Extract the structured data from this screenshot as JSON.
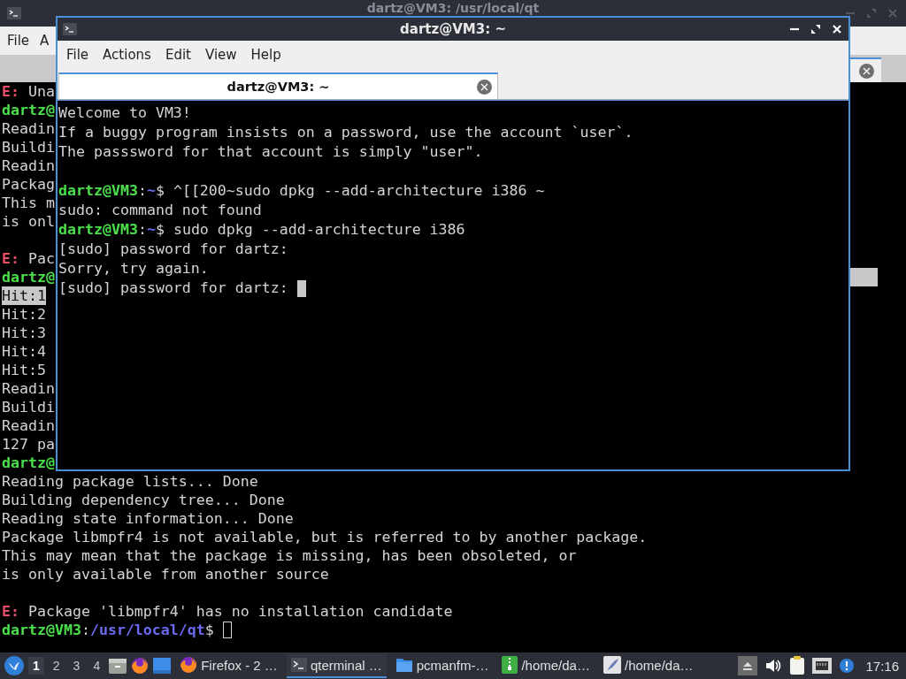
{
  "background_window": {
    "title": "dartz@VM3: /usr/local/qt",
    "focused": false,
    "menu": [
      "File",
      "A"
    ],
    "lines": [
      {
        "kind": "text",
        "parts": [
          {
            "kind": "error",
            "text": "E:"
          },
          {
            "kind": "plain",
            "text": " Una"
          }
        ]
      },
      {
        "kind": "text",
        "parts": [
          {
            "kind": "user",
            "text": "dartz@"
          }
        ]
      },
      {
        "kind": "text",
        "parts": [
          {
            "kind": "plain",
            "text": "Readin"
          }
        ]
      },
      {
        "kind": "text",
        "parts": [
          {
            "kind": "plain",
            "text": "Buildi"
          }
        ]
      },
      {
        "kind": "text",
        "parts": [
          {
            "kind": "plain",
            "text": "Readin"
          }
        ]
      },
      {
        "kind": "text",
        "parts": [
          {
            "kind": "plain",
            "text": "Packag"
          }
        ]
      },
      {
        "kind": "text",
        "parts": [
          {
            "kind": "plain",
            "text": "This m"
          }
        ]
      },
      {
        "kind": "text",
        "parts": [
          {
            "kind": "plain",
            "text": "is onl"
          }
        ]
      },
      {
        "kind": "blank"
      },
      {
        "kind": "text",
        "parts": [
          {
            "kind": "error",
            "text": "E:"
          },
          {
            "kind": "plain",
            "text": " Pac"
          }
        ]
      },
      {
        "kind": "text",
        "selected_end": true,
        "parts": [
          {
            "kind": "user",
            "text": "dartz@"
          }
        ]
      },
      {
        "kind": "text",
        "selected": true,
        "parts": [
          {
            "kind": "plain",
            "text": "Hit:1"
          }
        ]
      },
      {
        "kind": "text",
        "parts": [
          {
            "kind": "plain",
            "text": "Hit:2"
          }
        ]
      },
      {
        "kind": "text",
        "parts": [
          {
            "kind": "plain",
            "text": "Hit:3"
          }
        ]
      },
      {
        "kind": "text",
        "parts": [
          {
            "kind": "plain",
            "text": "Hit:4"
          }
        ]
      },
      {
        "kind": "text",
        "parts": [
          {
            "kind": "plain",
            "text": "Hit:5"
          }
        ]
      },
      {
        "kind": "text",
        "parts": [
          {
            "kind": "plain",
            "text": "Readin"
          }
        ]
      },
      {
        "kind": "text",
        "parts": [
          {
            "kind": "plain",
            "text": "Buildi"
          }
        ]
      },
      {
        "kind": "text",
        "parts": [
          {
            "kind": "plain",
            "text": "Readin"
          }
        ]
      },
      {
        "kind": "text",
        "parts": [
          {
            "kind": "plain",
            "text": "127 pa"
          }
        ]
      },
      {
        "kind": "text",
        "parts": [
          {
            "kind": "user",
            "text": "dartz@"
          }
        ]
      },
      {
        "kind": "text",
        "parts": [
          {
            "kind": "plain",
            "text": "Reading package lists... Done"
          }
        ]
      },
      {
        "kind": "text",
        "parts": [
          {
            "kind": "plain",
            "text": "Building dependency tree... Done"
          }
        ]
      },
      {
        "kind": "text",
        "parts": [
          {
            "kind": "plain",
            "text": "Reading state information... Done"
          }
        ]
      },
      {
        "kind": "text",
        "parts": [
          {
            "kind": "plain",
            "text": "Package libmpfr4 is not available, but is referred to by another package."
          }
        ]
      },
      {
        "kind": "text",
        "parts": [
          {
            "kind": "plain",
            "text": "This may mean that the package is missing, has been obsoleted, or"
          }
        ]
      },
      {
        "kind": "text",
        "parts": [
          {
            "kind": "plain",
            "text": "is only available from another source"
          }
        ]
      },
      {
        "kind": "blank"
      },
      {
        "kind": "text",
        "parts": [
          {
            "kind": "error",
            "text": "E:"
          },
          {
            "kind": "plain",
            "text": " Package 'libmpfr4' has no installation candidate"
          }
        ]
      },
      {
        "kind": "text",
        "cursor": true,
        "parts": [
          {
            "kind": "user",
            "text": "dartz@VM3"
          },
          {
            "kind": "plain",
            "text": ":"
          },
          {
            "kind": "path",
            "text": "/usr/local/qt"
          },
          {
            "kind": "plain",
            "text": "$"
          }
        ]
      }
    ]
  },
  "foreground_window": {
    "title": "dartz@VM3: ~",
    "focused": true,
    "menu": [
      "File",
      "Actions",
      "Edit",
      "View",
      "Help"
    ],
    "tabs": [
      {
        "label": "dartz@VM3: ~",
        "selected": true
      }
    ],
    "lines": [
      {
        "kind": "text",
        "parts": [
          {
            "kind": "plain",
            "text": "Welcome to VM3!"
          }
        ]
      },
      {
        "kind": "text",
        "parts": [
          {
            "kind": "plain",
            "text": "If a buggy program insists on a password, use the account `user`."
          }
        ]
      },
      {
        "kind": "text",
        "parts": [
          {
            "kind": "plain",
            "text": "The passsword for that account is simply \"user\"."
          }
        ]
      },
      {
        "kind": "blank"
      },
      {
        "kind": "text",
        "parts": [
          {
            "kind": "user",
            "text": "dartz@VM3"
          },
          {
            "kind": "plain",
            "text": ":"
          },
          {
            "kind": "path",
            "text": "~"
          },
          {
            "kind": "plain",
            "text": "$ ^[[200~sudo dpkg --add-architecture i386 ~"
          }
        ]
      },
      {
        "kind": "text",
        "parts": [
          {
            "kind": "plain",
            "text": "sudo: command not found"
          }
        ]
      },
      {
        "kind": "text",
        "parts": [
          {
            "kind": "user",
            "text": "dartz@VM3"
          },
          {
            "kind": "plain",
            "text": ":"
          },
          {
            "kind": "path",
            "text": "~"
          },
          {
            "kind": "plain",
            "text": "$ sudo dpkg --add-architecture i386"
          }
        ]
      },
      {
        "kind": "text",
        "parts": [
          {
            "kind": "plain",
            "text": "[sudo] password for dartz:"
          }
        ]
      },
      {
        "kind": "text",
        "parts": [
          {
            "kind": "plain",
            "text": "Sorry, try again."
          }
        ]
      },
      {
        "kind": "text",
        "cursor": true,
        "parts": [
          {
            "kind": "plain",
            "text": "[sudo] password for dartz:"
          }
        ]
      }
    ]
  },
  "taskbar": {
    "desktops": [
      {
        "label": "1",
        "selected": true
      },
      {
        "label": "2",
        "selected": false
      },
      {
        "label": "3",
        "selected": false
      },
      {
        "label": "4",
        "selected": false
      }
    ],
    "tasks": [
      {
        "kind": "browser",
        "label": "Firefox - 2 …",
        "selected": false
      },
      {
        "kind": "terminal",
        "label": "qterminal …",
        "selected": true
      },
      {
        "kind": "folder",
        "label": "pcmanfm-…",
        "selected": false
      },
      {
        "kind": "archive",
        "label": "/home/da…",
        "selected": false
      },
      {
        "kind": "editor",
        "label": "/home/da…",
        "selected": false
      }
    ],
    "clock": "17:16"
  }
}
